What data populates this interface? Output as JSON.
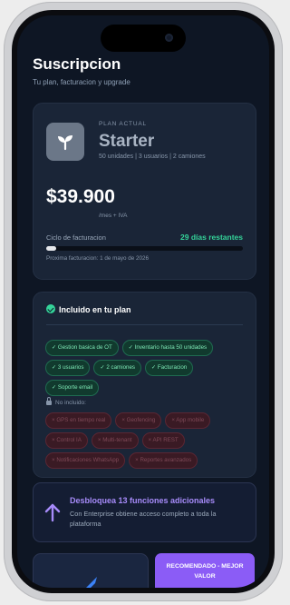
{
  "header": {
    "title": "Suscripcion",
    "subtitle": "Tu plan, facturacion y upgrade"
  },
  "plan": {
    "label": "PLAN ACTUAL",
    "name": "Starter",
    "details": "50 unidades | 3 usuarios | 2 camiones",
    "price": "$39.900",
    "period": "/mes + IVA",
    "cycle_label": "Ciclo de facturacion",
    "days_left": "29 días restantes",
    "progress_fraction": 0.03,
    "next_billing": "Proxima facturacion: 1 de mayo de 2026",
    "logo_icon": "sprout-icon"
  },
  "included": {
    "heading": "Incluido en tu plan",
    "features": [
      "✓ Gestion basica de OT",
      "✓ Inventario hasta 50 unidades",
      "✓ 3 usuarios",
      "✓ 2 camiones",
      "✓ Facturacion",
      "✓ Soporte email"
    ],
    "not_included_label": "No incluido:",
    "not_included": [
      "× GPS en tiempo real",
      "× Geofencing",
      "× App mobile",
      "× Control IA",
      "× Multi-tenant",
      "× API REST",
      "× Notificaciones WhatsApp",
      "× Reportes avanzados"
    ]
  },
  "upsell": {
    "title": "Desbloquea 13 funciones adicionales",
    "description": "Con Enterprise obtiene acceso completo a toda la plataforma"
  },
  "footer": {
    "recommended_line1": "RECOMENDADO - MEJOR",
    "recommended_line2": "VALOR"
  },
  "colors": {
    "background": "#0e1624",
    "card": "#1a2537",
    "accent_green": "#34d399",
    "accent_purple": "#8b5cf6"
  }
}
